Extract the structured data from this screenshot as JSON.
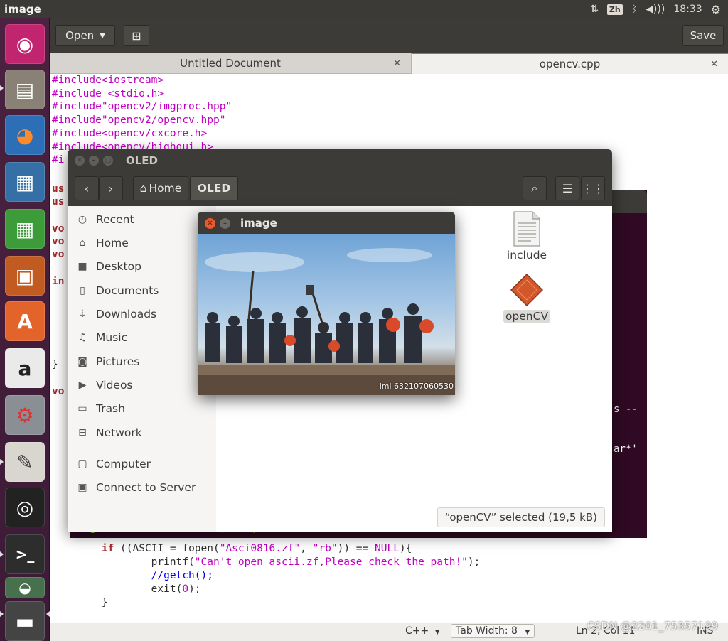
{
  "top_panel": {
    "app_title": "image",
    "ime": "Zh",
    "clock": "18:33"
  },
  "launcher": {
    "items": [
      {
        "name": "ubuntu-dash",
        "glyph": "◉",
        "color": "#c2256f"
      },
      {
        "name": "files",
        "glyph": "▤",
        "color": "#8a8176"
      },
      {
        "name": "firefox",
        "glyph": "◕",
        "color": "#e8672b"
      },
      {
        "name": "writer",
        "glyph": "▦",
        "color": "#3470a6"
      },
      {
        "name": "calc",
        "glyph": "▦",
        "color": "#3d9b3a"
      },
      {
        "name": "impress",
        "glyph": "▣",
        "color": "#c15b22"
      },
      {
        "name": "software",
        "glyph": "A",
        "color": "#e3642a"
      },
      {
        "name": "amazon",
        "glyph": "a",
        "color": "#eaeaea"
      },
      {
        "name": "settings",
        "glyph": "⚙",
        "color": "#8a8f96"
      },
      {
        "name": "text-editor",
        "glyph": "✎",
        "color": "#d9d6cf"
      },
      {
        "name": "safe",
        "glyph": "◎",
        "color": "#222222"
      },
      {
        "name": "terminal",
        "glyph": ">_",
        "color": "#2d2d2d"
      },
      {
        "name": "software-updater",
        "glyph": "◒",
        "color": "#47704d"
      },
      {
        "name": "display",
        "glyph": "▬",
        "color": "#444444"
      }
    ]
  },
  "gedit": {
    "open_label": "Open",
    "save_label": "Save",
    "tabs": [
      {
        "label": "Untitled Document"
      },
      {
        "label": "opencv.cpp"
      }
    ],
    "code_top": [
      "#include<iostream>",
      "#include <stdio.h>",
      "#include\"opencv2/imgproc.hpp\"",
      "#include\"opencv2/opencv.hpp\"",
      "#include<opencv/cxcore.h>",
      "#include<opencv/highgui.h>",
      "#i"
    ],
    "code_left_fragments": [
      "us",
      "us",
      "vo",
      "vo",
      "vo",
      "in",
      "}",
      "vo"
    ],
    "code_bottom": [
      "        if ((ASCII = fopen(\"Asci0816.zf\", \"rb\")) == NULL){",
      "                printf(\"Can't open ascii.zf,Please check the path!\");",
      "                //getch();",
      "                exit(0);",
      "        }"
    ],
    "status": {
      "language": "C++",
      "tab_width": "Tab Width: 8",
      "position": "Ln 2, Col 11",
      "mode": "INS"
    }
  },
  "terminal": {
    "prompt": "lml@lml-virtual-machine:~/OLED$",
    "fragment_1": "s --",
    "fragment_2": "ar*'"
  },
  "nautilus": {
    "title": "OLED",
    "path": {
      "home": "Home",
      "current": "OLED"
    },
    "sidebar": [
      {
        "label": "Recent",
        "icon": "clock-icon",
        "glyph": "◷"
      },
      {
        "label": "Home",
        "icon": "home-icon",
        "glyph": "⌂"
      },
      {
        "label": "Desktop",
        "icon": "folder-icon",
        "glyph": "■"
      },
      {
        "label": "Documents",
        "icon": "document-icon",
        "glyph": "▯"
      },
      {
        "label": "Downloads",
        "icon": "download-icon",
        "glyph": "⇣"
      },
      {
        "label": "Music",
        "icon": "music-icon",
        "glyph": "♫"
      },
      {
        "label": "Pictures",
        "icon": "camera-icon",
        "glyph": "◙"
      },
      {
        "label": "Videos",
        "icon": "video-icon",
        "glyph": "▶"
      },
      {
        "label": "Trash",
        "icon": "trash-icon",
        "glyph": "▭"
      },
      {
        "label": "Network",
        "icon": "network-icon",
        "glyph": "⊟"
      },
      {
        "label": "Computer",
        "icon": "computer-icon",
        "glyph": "▢"
      },
      {
        "label": "Connect to Server",
        "icon": "server-icon",
        "glyph": "▣"
      }
    ],
    "files": [
      {
        "label": "include",
        "icon": "text-file-icon"
      },
      {
        "label": "openCV",
        "icon": "executable-icon"
      }
    ],
    "status": "“openCV” selected  (19,5 kB)"
  },
  "image_window": {
    "title": "image",
    "caption": "lml 632107060530"
  },
  "watermark": "CSDN @2201_75357199"
}
